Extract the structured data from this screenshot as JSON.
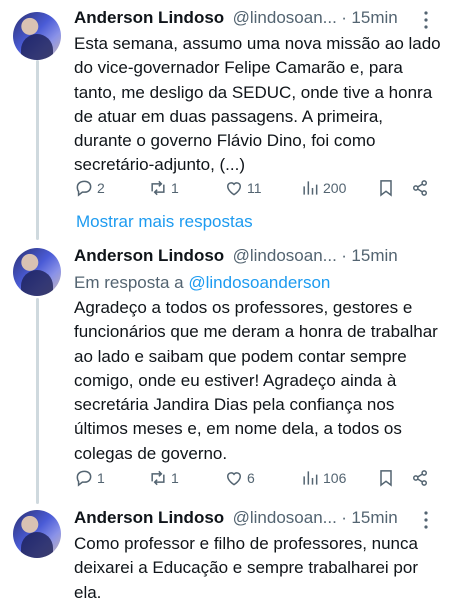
{
  "tweets": [
    {
      "name": "Anderson Lindoso",
      "handle": "@lindosoan...",
      "dot": "·",
      "time": "15min",
      "text": "Esta semana, assumo uma nova missão ao lado do vice-governador Felipe Camarão e, para tanto, me desligo da SEDUC, onde tive a honra de atuar em duas passagens. A primeira, durante o governo Flávio Dino, foi como secretário-adjunto, (...)",
      "replies": "2",
      "retweets": "1",
      "likes": "11",
      "views": "200"
    },
    {
      "name": "Anderson Lindoso",
      "handle": "@lindosoan...",
      "dot": "·",
      "time": "15min",
      "reply_prefix": "Em resposta a",
      "reply_mention": "@lindosoanderson",
      "text": "Agradeço a todos os professores, gestores e funcionários que me deram a honra de trabalhar ao lado e saibam que podem contar sempre comigo, onde eu estiver! Agradeço ainda à secretária Jandira Dias pela confiança nos últimos meses e, em nome dela, a todos os colegas de governo.",
      "replies": "1",
      "retweets": "1",
      "likes": "6",
      "views": "106"
    },
    {
      "name": "Anderson Lindoso",
      "handle": "@lindosoan...",
      "dot": "·",
      "time": "15min",
      "text": "Como professor e filho de professores, nunca deixarei a Educação e sempre trabalharei por ela."
    }
  ],
  "show_more_label": "Mostrar mais respostas",
  "colors": {
    "accent": "#1d9bf0",
    "muted": "#536471",
    "text": "#0f1419",
    "thread_line": "#cfd9de"
  },
  "icons": [
    "reply-icon",
    "retweet-icon",
    "like-icon",
    "views-icon",
    "bookmark-icon",
    "share-icon",
    "more-icon"
  ]
}
